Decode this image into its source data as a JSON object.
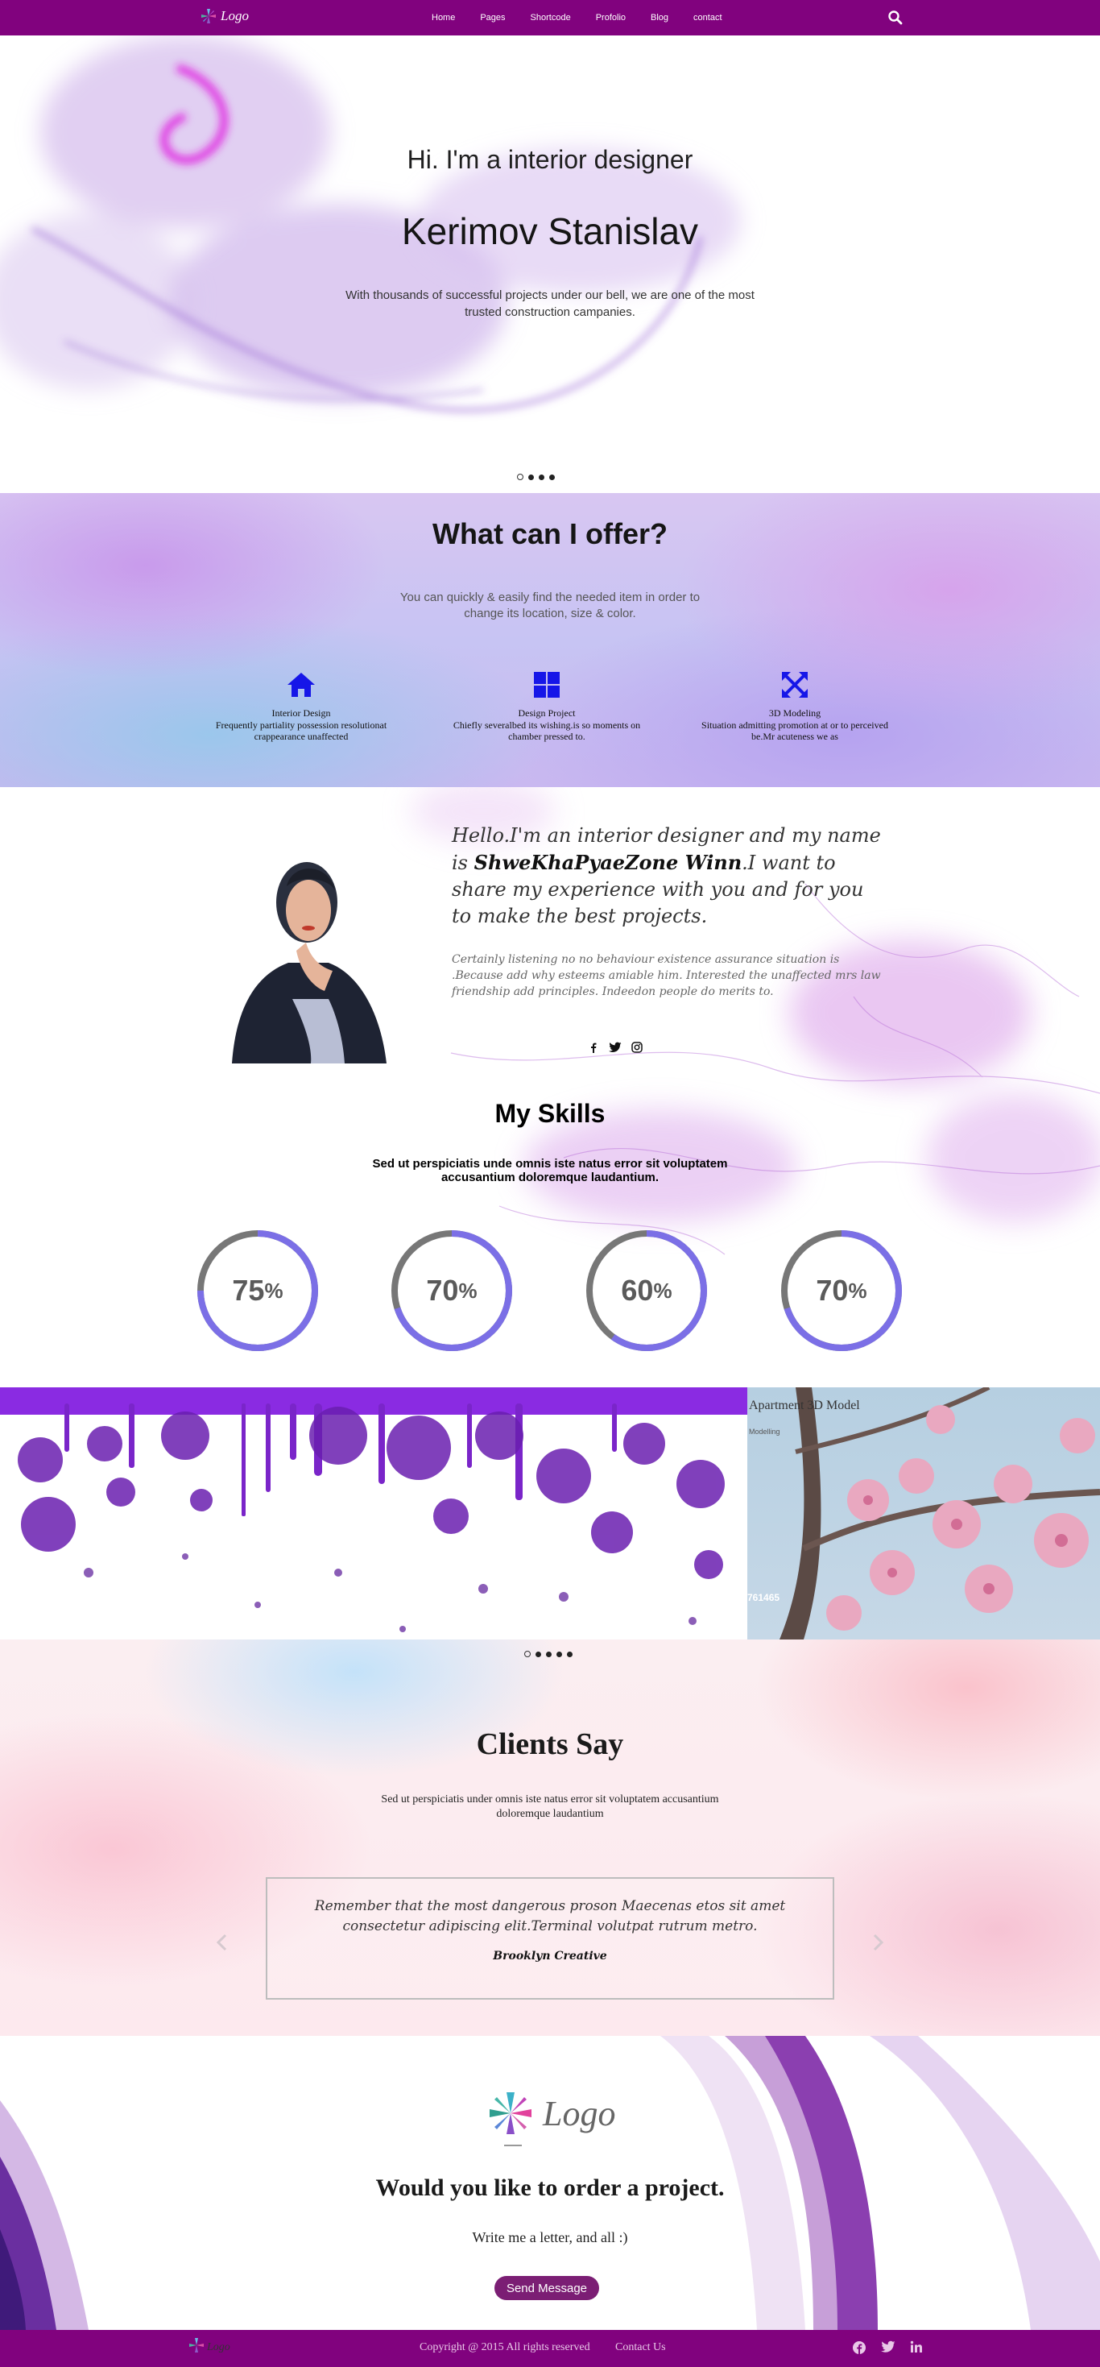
{
  "nav": {
    "logo_text": "Logo",
    "items": [
      "Home",
      "Pages",
      "Shortcode",
      "Profolio",
      "Blog",
      "contact"
    ]
  },
  "hero": {
    "subtitle": "Hi. I'm a interior designer",
    "title": "Kerimov Stanislav",
    "description": "With thousands of successful projects under our bell, we are one of the most trusted construction campanies."
  },
  "offer": {
    "title": "What can I offer?",
    "description": "You can quickly & easily find the needed item in order to change its location, size & color.",
    "features": [
      {
        "icon": "home-icon",
        "name": "Interior Design",
        "text": "Frequently partiality possession resolutionat crappearance unaffected"
      },
      {
        "icon": "grid-icon",
        "name": "Design Project",
        "text": "Chiefly severalbed its wishing.is so moments on chamber pressed to."
      },
      {
        "icon": "expand-icon",
        "name": "3D Modeling",
        "text": "Situation admitting promotion at or to perceived be.Mr acuteness we as"
      }
    ]
  },
  "about": {
    "lead_start": "Hello.I'm an interior designer and my name is ",
    "lead_name": "ShweKhaPyaeZone Winn",
    "lead_end": ".I want to share my experience with you and for you to make the best projects.",
    "body": "Certainly listening no no behaviour existence assurance situation is .Because add why esteems amiable him. Interested the unaffected mrs law friendship add principles. Indeedon people do merits to.",
    "social": [
      "facebook-icon",
      "twitter-icon",
      "instagram-icon"
    ]
  },
  "skills": {
    "title": "My Skills",
    "description": "Sed ut perspiciatis unde omnis iste natus error sit voluptatem accusantium doloremque laudantium.",
    "items": [
      {
        "value": 75,
        "unit": "%",
        "fill": 0.75
      },
      {
        "value": 70,
        "unit": "%",
        "fill": 0.7
      },
      {
        "value": 60,
        "unit": "%",
        "fill": 0.6
      },
      {
        "value": 70,
        "unit": "%",
        "fill": 0.7
      }
    ],
    "colors": {
      "track": "#777777",
      "progress": "#7b6fe6"
    }
  },
  "portfolio": {
    "item_title": "Apartment 3D Model",
    "item_category": "Modelling",
    "item_number": "761465"
  },
  "clients": {
    "title": "Clients Say",
    "description": "Sed ut perspiciatis under omnis iste natus error sit voluptatem accusantium doloremque laudantium",
    "quote": "Remember that the most dangerous proson Maecenas etos sit amet consectetur adipiscing elit.Terminal volutpat rutrum metro.",
    "author": "Brooklyn Creative"
  },
  "contact": {
    "logo_text": "Logo",
    "title": "Would you like to order a project.",
    "subtitle": "Write me a letter, and all :)",
    "button_label": "Send Message"
  },
  "footer": {
    "logo_text": "Logo",
    "copyright": "Copyright @ 2015 All rights reserved",
    "contact_label": "Contact Us",
    "social": [
      "facebook-icon",
      "twitter-icon",
      "linkedin-icon"
    ]
  },
  "colors": {
    "brand": "#81027e",
    "accent_blue": "#1616e8",
    "button": "#7b1e74"
  }
}
